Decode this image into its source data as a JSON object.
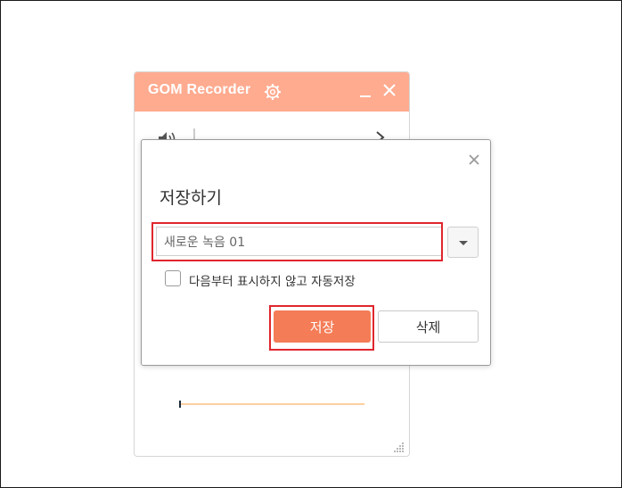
{
  "recorder": {
    "title": "GOM Recorder",
    "accent_color": "#ffab90",
    "icons": [
      "gear-icon",
      "minimize-icon",
      "close-icon",
      "speaker-icon",
      "chevron-right-icon",
      "resize-grip-icon"
    ]
  },
  "dialog": {
    "title": "저장하기",
    "filename_value": "새로운 녹음 01",
    "auto_save_label": "다음부터 표시하지 않고 자동저장",
    "auto_save_checked": false,
    "save_label": "저장",
    "delete_label": "삭제",
    "save_color": "#f47c56",
    "highlight_color": "#e0262e"
  }
}
